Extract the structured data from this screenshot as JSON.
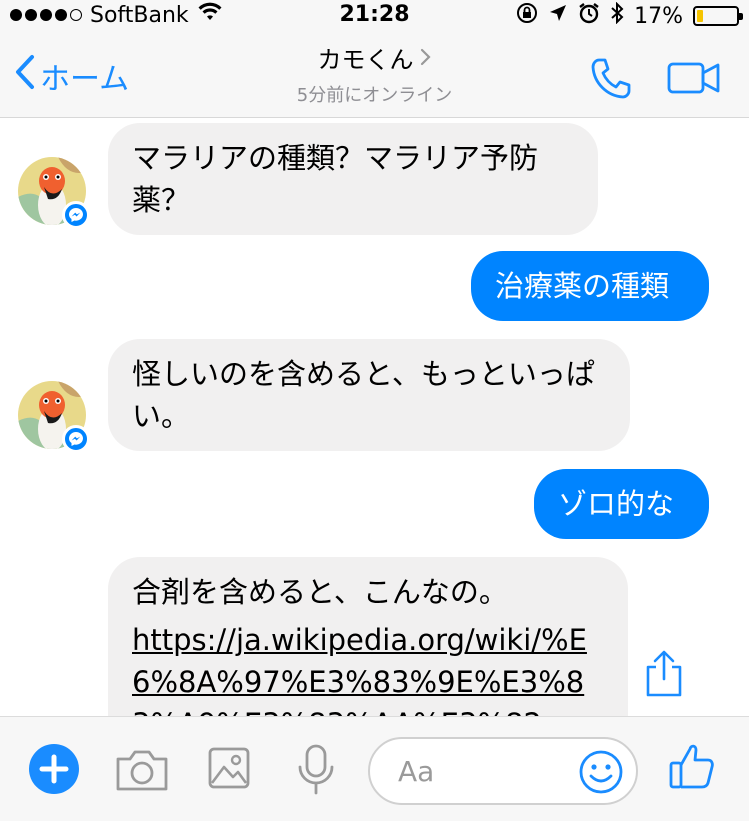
{
  "status_bar": {
    "carrier": "SoftBank",
    "time": "21:28",
    "battery": "17%",
    "battery_level": 0.17
  },
  "nav": {
    "back_label": "ホーム",
    "title": "カモくん",
    "subtitle": "5分前にオンライン"
  },
  "messages": [
    {
      "sender": "contact",
      "text": "マラリアの種類？マラリア予防薬？"
    },
    {
      "sender": "me",
      "text": "治療薬の種類"
    },
    {
      "sender": "contact",
      "text": "怪しいのを含めると、もっといっぱい。"
    },
    {
      "sender": "me",
      "text": "ゾロ的な"
    },
    {
      "sender": "contact",
      "text": "合剤を含めると、こんなの。",
      "link": "https://ja.wikipedia.org/wiki/%E6%8A%97%E3%83%9E%E3%83%A9%E3%83%AA%E3%82"
    }
  ],
  "composer": {
    "placeholder": "Aa"
  },
  "colors": {
    "accent": "#0084ff",
    "ios_blue": "#1a8cff",
    "incoming_bubble": "#f1f0f0",
    "battery": "#f5c400"
  },
  "icons": {
    "back": "chevron-left-icon",
    "phone": "phone-icon",
    "video": "video-camera-icon",
    "plus": "plus-icon",
    "camera": "camera-icon",
    "image": "image-icon",
    "mic": "microphone-icon",
    "emoji": "smile-icon",
    "like": "thumbs-up-icon",
    "share": "share-icon"
  }
}
